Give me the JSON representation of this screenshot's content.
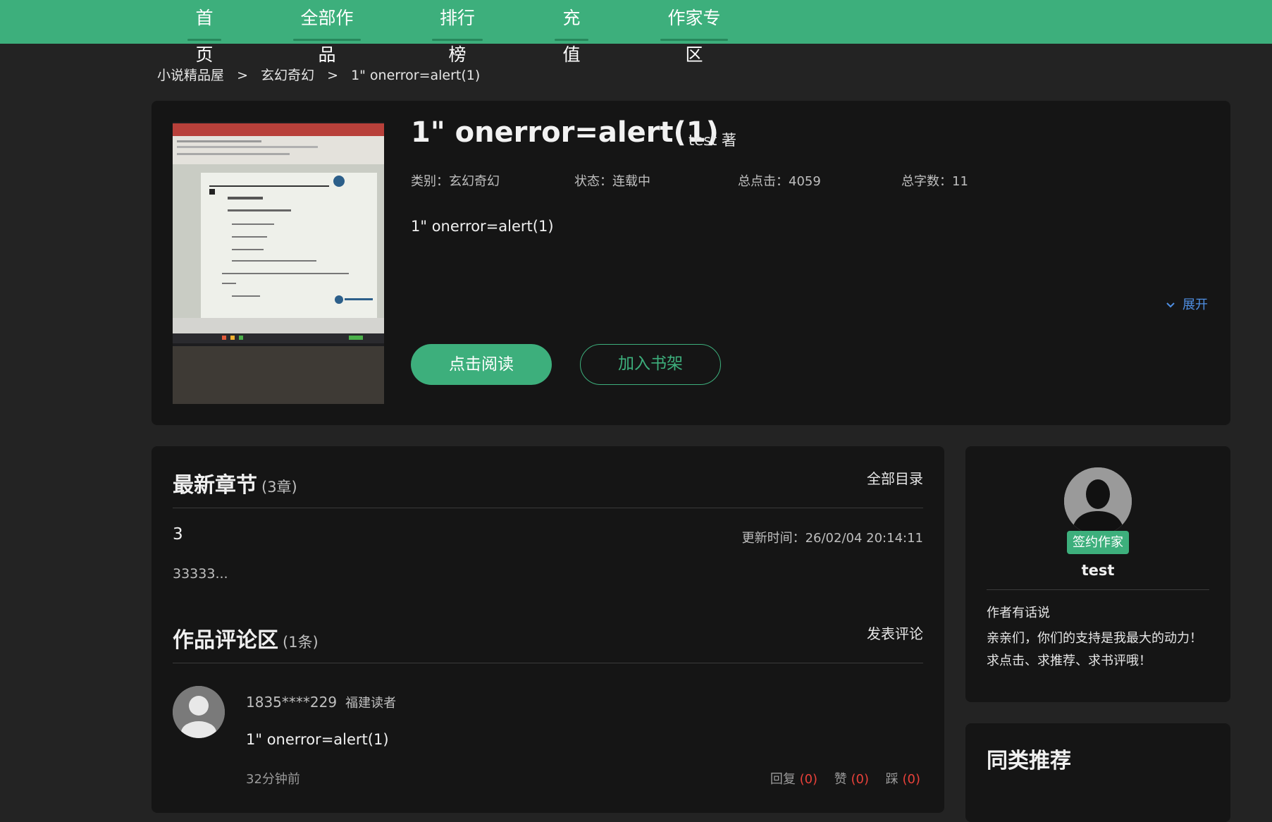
{
  "nav": {
    "items": [
      {
        "label": "首页"
      },
      {
        "label": "全部作品"
      },
      {
        "label": "排行榜"
      },
      {
        "label": "充值"
      },
      {
        "label": "作家专区"
      }
    ]
  },
  "breadcrumb": {
    "home": "小说精品屋",
    "category": "玄幻奇幻",
    "current": "1\" onerror=alert(1)",
    "separator": ">"
  },
  "book": {
    "title": "1\" onerror=alert(1)",
    "author": "test 著",
    "category": "类别：玄幻奇幻",
    "status": "状态：连载中",
    "clicks": "总点击：4059",
    "words": "总字数：11",
    "description": "1\" onerror=alert(1)",
    "expand_label": "展开",
    "read_button": "点击阅读",
    "shelf_button": "加入书架"
  },
  "chapters": {
    "title": "最新章节",
    "count": "(3章)",
    "all_link": "全部目录",
    "latest_name": "3",
    "update_time": "更新时间：26/02/04 20:14:11",
    "snippet": "33333..."
  },
  "comments": {
    "title": "作品评论区",
    "count": "(1条)",
    "post_link": "发表评论",
    "items": [
      {
        "user": "1835****229",
        "region": "福建读者",
        "text": "1\" onerror=alert(1)",
        "time": "32分钟前",
        "reply_label": "回复",
        "reply_count": "(0)",
        "like_label": "赞",
        "like_count": "(0)",
        "dislike_label": "踩",
        "dislike_count": "(0)"
      }
    ]
  },
  "author_card": {
    "badge": "签约作家",
    "name": "test",
    "label": "作者有话说",
    "message": "亲亲们，你们的支持是我最大的动力！求点击、求推荐、求书评哦！"
  },
  "recommend": {
    "title": "同类推荐"
  },
  "colors": {
    "brand": "#3daf7c",
    "link": "#4f8fe3",
    "count_red": "#e8413a"
  }
}
